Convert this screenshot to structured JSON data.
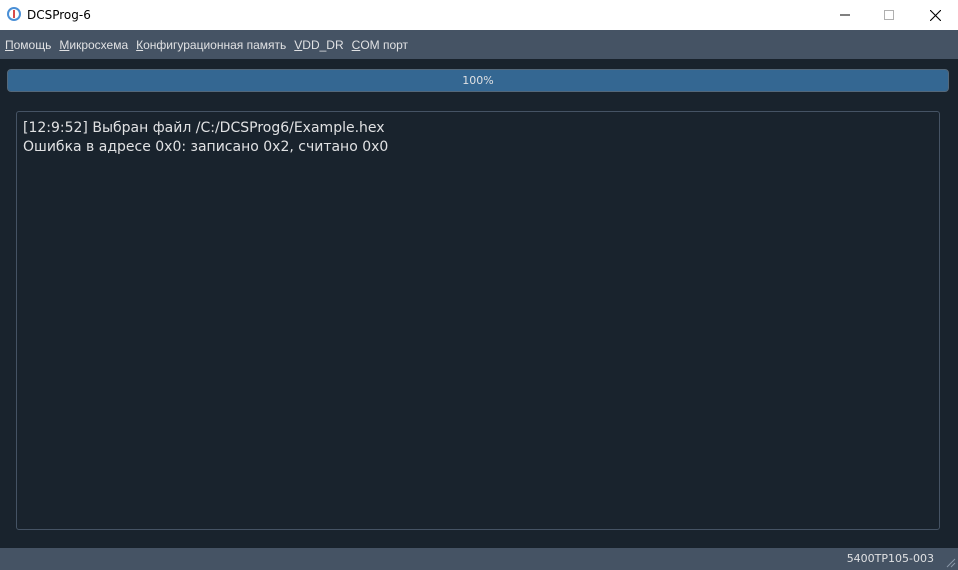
{
  "window": {
    "title": "DCSProg-6",
    "icon": "dcsprog-logo-icon",
    "controls": [
      "minimize-icon",
      "maximize-icon",
      "close-icon"
    ]
  },
  "menu": {
    "items": [
      {
        "accel": "П",
        "rest": "омощь"
      },
      {
        "accel": "М",
        "rest": "икросхема"
      },
      {
        "accel": "К",
        "rest": "онфигурационная память"
      },
      {
        "accel": "V",
        "rest": "DD_DR"
      },
      {
        "accel": "C",
        "rest": "OM порт"
      }
    ]
  },
  "progress": {
    "value": 100,
    "label": "100%"
  },
  "log": {
    "lines": [
      "[12:9:52] Выбран файл /C:/DCSProg6/Example.hex",
      "Ошибка в адресе 0x0: записано 0x2, считано 0x0"
    ]
  },
  "status": {
    "device": "5400TP105-003"
  },
  "colors": {
    "background": "#19232d",
    "panel": "#455364",
    "accent": "#346792",
    "text": "#e0e1e3"
  }
}
